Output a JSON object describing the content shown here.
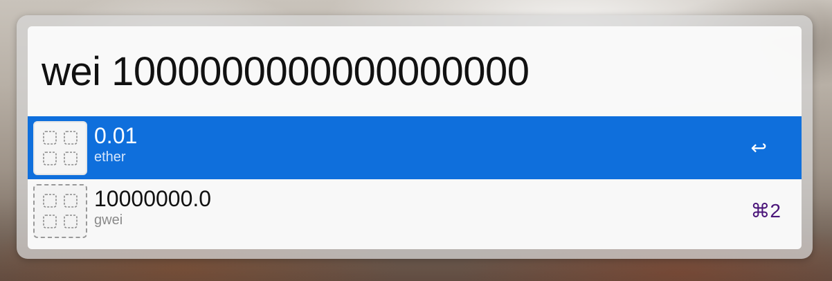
{
  "launcher": {
    "query": "wei 1000000000000000000",
    "results": [
      {
        "title": "0.01",
        "subtitle": "ether",
        "shortcut": "↩",
        "selected": true,
        "icon": "placeholder-grid-icon"
      },
      {
        "title": "10000000.0",
        "subtitle": "gwei",
        "shortcut": "⌘2",
        "selected": false,
        "icon": "placeholder-grid-icon"
      }
    ]
  },
  "colors": {
    "selection": "#0f6fdc",
    "shortcut": "#4a1479"
  }
}
